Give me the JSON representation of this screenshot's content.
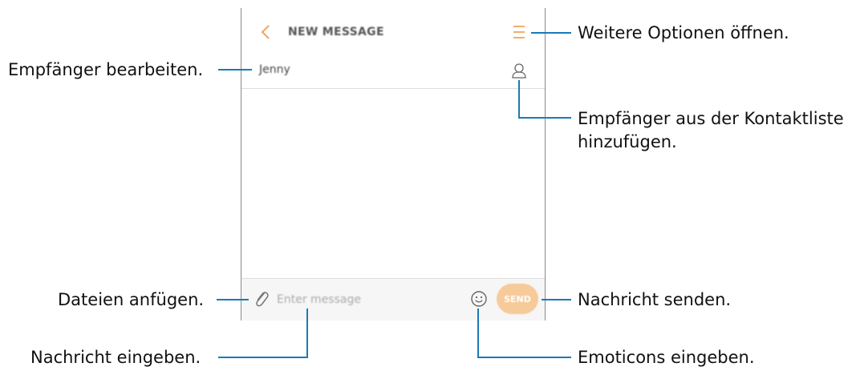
{
  "phone": {
    "title": "NEW MESSAGE",
    "recipient": "Jenny",
    "input_placeholder": "Enter message",
    "send_label": "SEND"
  },
  "callouts": {
    "more_options": "Weitere Optionen öffnen.",
    "edit_recipients": "Empfänger bearbeiten.",
    "add_from_contacts_line1": "Empfänger aus der Kontaktliste",
    "add_from_contacts_line2": "hinzufügen.",
    "attach_files": "Dateien anfügen.",
    "send_message": "Nachricht senden.",
    "enter_message": "Nachricht eingeben.",
    "enter_emoticons": "Emoticons eingeben."
  },
  "colors": {
    "accent_orange": "#f0a45d",
    "send_button": "#f6ca99",
    "leader_blue": "#1a7ab8"
  },
  "icons": [
    "back-icon",
    "more-icon",
    "contact-icon",
    "attach-icon",
    "emoticon-icon"
  ]
}
